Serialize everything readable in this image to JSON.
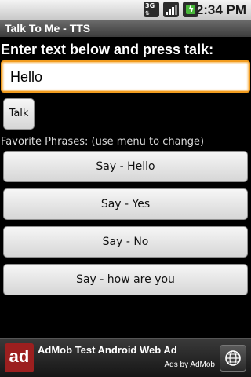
{
  "status_bar": {
    "network_label": "3G",
    "network_icon": "network-3g-icon",
    "signal_icon": "signal-strength-icon",
    "battery_icon": "battery-charging-icon",
    "time": "2:34 PM"
  },
  "title_bar": {
    "title": "Talk To Me - TTS"
  },
  "main": {
    "prompt": "Enter text below and press talk:",
    "input_value": "Hello",
    "talk_label": "Talk",
    "favorites_label": "Favorite Phrases: (use menu to change)",
    "phrases": [
      "Say - Hello",
      "Say - Yes",
      "Say - No",
      "Say -  how are you"
    ]
  },
  "ad_banner": {
    "logo_text": "ad",
    "title": "AdMob Test Android Web Ad",
    "byline": "Ads by AdMob",
    "globe_icon": "globe-icon"
  },
  "colors": {
    "input_focus": "#f29c1f",
    "background": "#000000",
    "ad_logo": "#9c1f1f"
  }
}
